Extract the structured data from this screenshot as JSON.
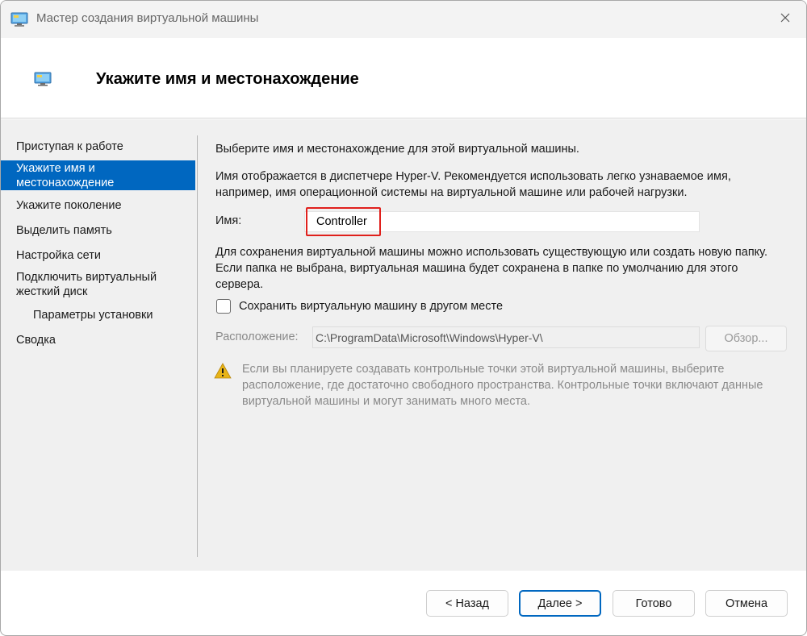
{
  "window": {
    "title": "Мастер создания виртуальной машины",
    "header_title": "Укажите имя и местонахождение"
  },
  "nav": {
    "items": [
      {
        "label": "Приступая к работе",
        "active": false
      },
      {
        "label": "Укажите имя и местонахождение",
        "active": true
      },
      {
        "label": "Укажите поколение",
        "active": false
      },
      {
        "label": "Выделить память",
        "active": false
      },
      {
        "label": "Настройка сети",
        "active": false
      },
      {
        "label": "Подключить виртуальный жесткий диск",
        "active": false
      },
      {
        "label": "Параметры установки",
        "active": false
      },
      {
        "label": "Сводка",
        "active": false
      }
    ]
  },
  "main": {
    "intro": "Выберите имя и местонахождение для этой виртуальной машины.",
    "name_hint": "Имя отображается в диспетчере Hyper-V. Рекомендуется использовать легко узнаваемое имя, например, имя операционной системы на виртуальной машине или рабочей нагрузки.",
    "name_label": "Имя:",
    "name_value": "Controller",
    "folder_hint": "Для сохранения виртуальной машины можно использовать существующую или создать новую папку. Если папка не выбрана, виртуальная машина будет сохранена в папке по умолчанию для этого сервера.",
    "store_elsewhere_label": "Сохранить виртуальную машину в другом месте",
    "store_elsewhere_checked": false,
    "location_label": "Расположение:",
    "location_value": "C:\\ProgramData\\Microsoft\\Windows\\Hyper-V\\",
    "browse_label": "Обзор...",
    "warning_text": "Если вы планируете создавать контрольные точки этой виртуальной машины, выберите расположение, где достаточно свободного пространства. Контрольные точки включают данные виртуальной машины и могут занимать много места."
  },
  "buttons": {
    "back": "< Назад",
    "next": "Далее >",
    "finish": "Готово",
    "cancel": "Отмена"
  },
  "colors": {
    "accent": "#0067c0",
    "highlight_box": "#e0201c",
    "warning": "#e8b417"
  }
}
